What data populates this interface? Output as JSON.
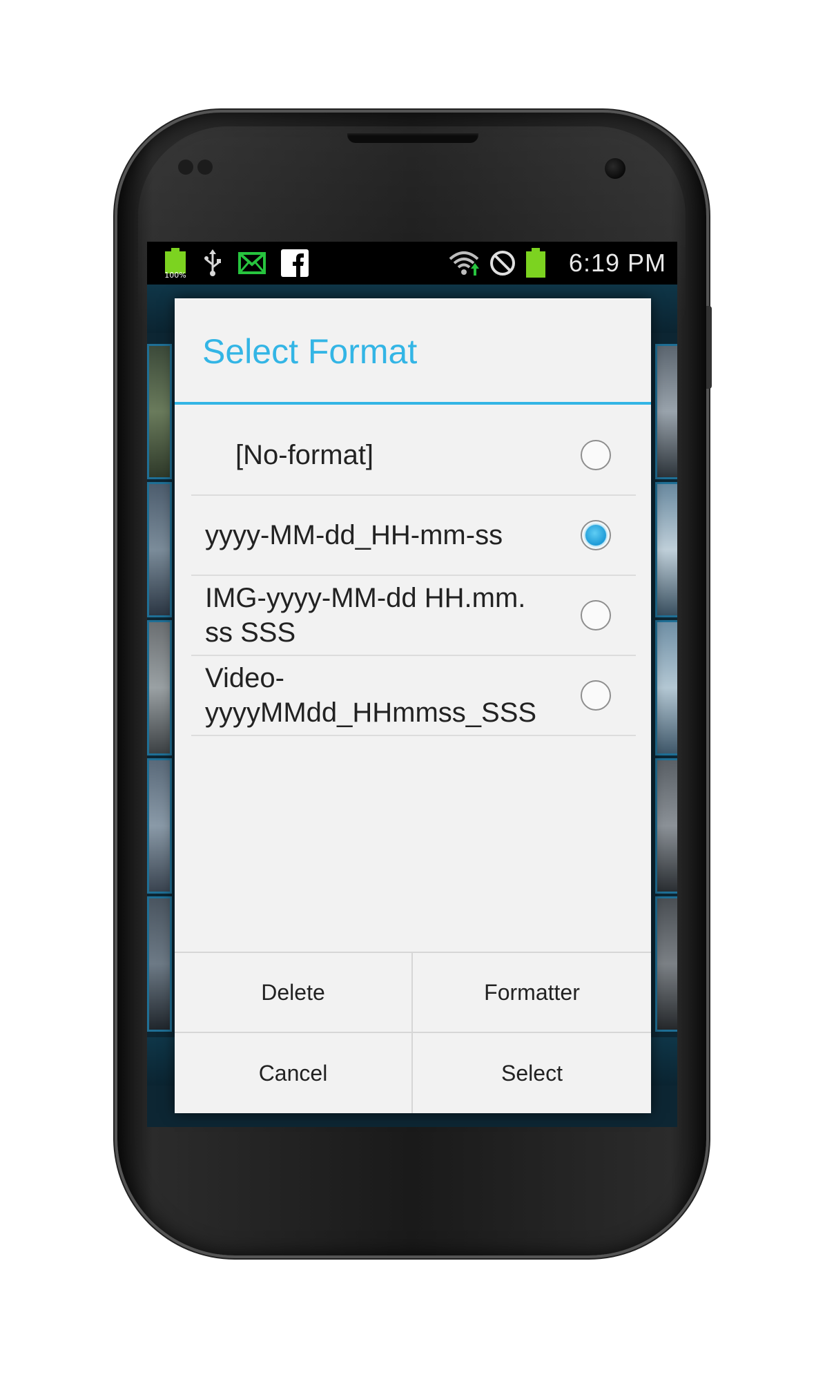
{
  "status_bar": {
    "battery_percent_label": "100%",
    "time": "6:19 PM",
    "colors": {
      "battery": "#7cd320",
      "mail": "#27c43e"
    },
    "icons": [
      "battery-charging-icon",
      "usb-icon",
      "mail-icon",
      "facebook-icon",
      "wifi-icon",
      "do-not-disturb-icon",
      "battery-icon"
    ]
  },
  "dialog": {
    "title": "Select Format",
    "accent_color": "#33b5e5",
    "options": [
      {
        "label": "[No-format]",
        "selected": false
      },
      {
        "label": "yyyy-MM-dd_HH-mm-ss",
        "selected": true
      },
      {
        "label": "IMG-yyyy-MM-dd HH.mm.\nss SSS",
        "selected": false
      },
      {
        "label": "Video-\nyyyyMMdd_HHmmss_SSS",
        "selected": false
      }
    ],
    "buttons": {
      "delete": "Delete",
      "formatter": "Formatter",
      "cancel": "Cancel",
      "select": "Select"
    }
  }
}
